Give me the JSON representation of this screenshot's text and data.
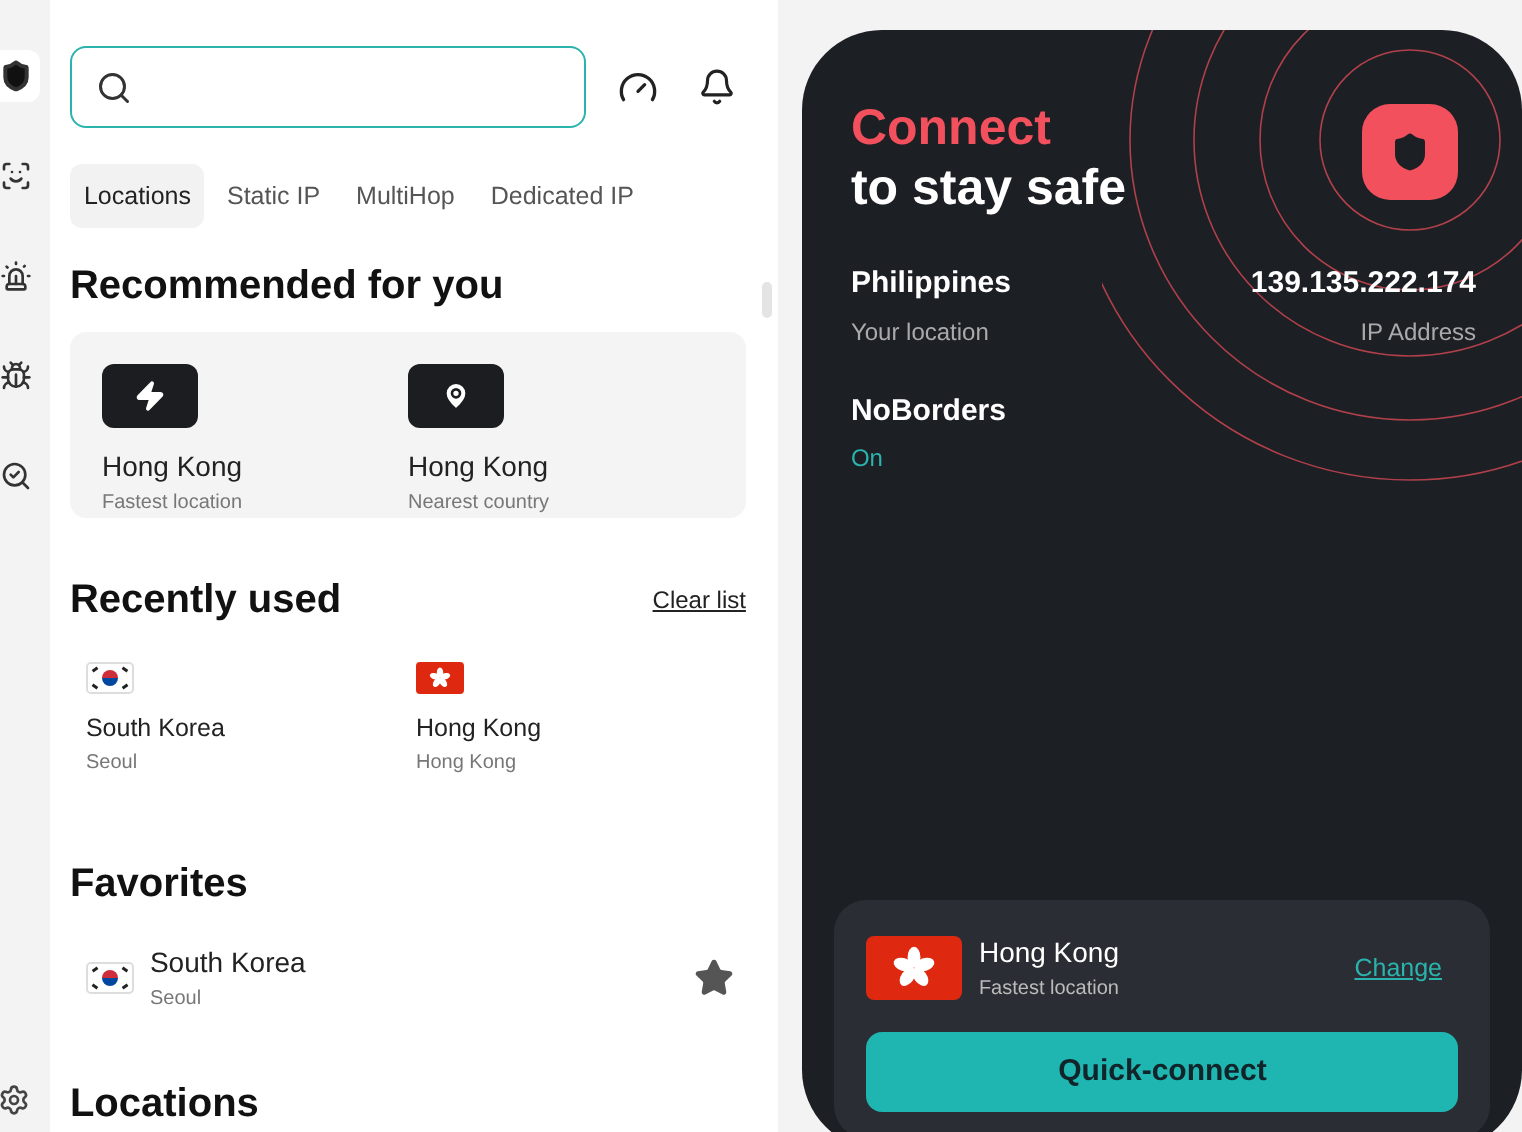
{
  "sidebar": {
    "items": [
      {
        "kind": "shield",
        "selected": true
      },
      {
        "kind": "person",
        "selected": false
      },
      {
        "kind": "alarm",
        "selected": false
      },
      {
        "kind": "bug",
        "selected": false
      },
      {
        "kind": "search",
        "selected": false
      }
    ]
  },
  "tabs": [
    {
      "label": "Locations",
      "selected": true
    },
    {
      "label": "Static IP",
      "selected": false
    },
    {
      "label": "MultiHop",
      "selected": false
    },
    {
      "label": "Dedicated IP",
      "selected": false
    }
  ],
  "recommended": {
    "title": "Recommended for you",
    "items": [
      {
        "kind": "fastest",
        "name": "Hong Kong",
        "detail": "Fastest location"
      },
      {
        "kind": "nearest",
        "name": "Hong Kong",
        "detail": "Nearest country"
      }
    ]
  },
  "recently_used": {
    "title": "Recently used",
    "action": "Clear list",
    "items": [
      {
        "kind": "kr",
        "name": "South Korea",
        "city": "Seoul"
      },
      {
        "kind": "hk",
        "name": "Hong Kong",
        "city": "Hong Kong"
      }
    ]
  },
  "favorites": {
    "title": "Favorites",
    "items": [
      {
        "kind": "kr",
        "name": "South Korea",
        "city": "Seoul",
        "favorite": true
      }
    ]
  },
  "locations": {
    "title": "Locations"
  },
  "status": {
    "title_accent": "Connect",
    "title": "to stay safe",
    "location": "Philippines",
    "location_label": "Your location",
    "ip": "139.135.222.174",
    "ip_label": "IP Address",
    "feature": "NoBorders",
    "feature_state": "On"
  },
  "quick_connect": {
    "kind": "hk",
    "name": "Hong Kong",
    "detail": "Fastest location",
    "action": "Change",
    "button": "Quick-connect"
  }
}
